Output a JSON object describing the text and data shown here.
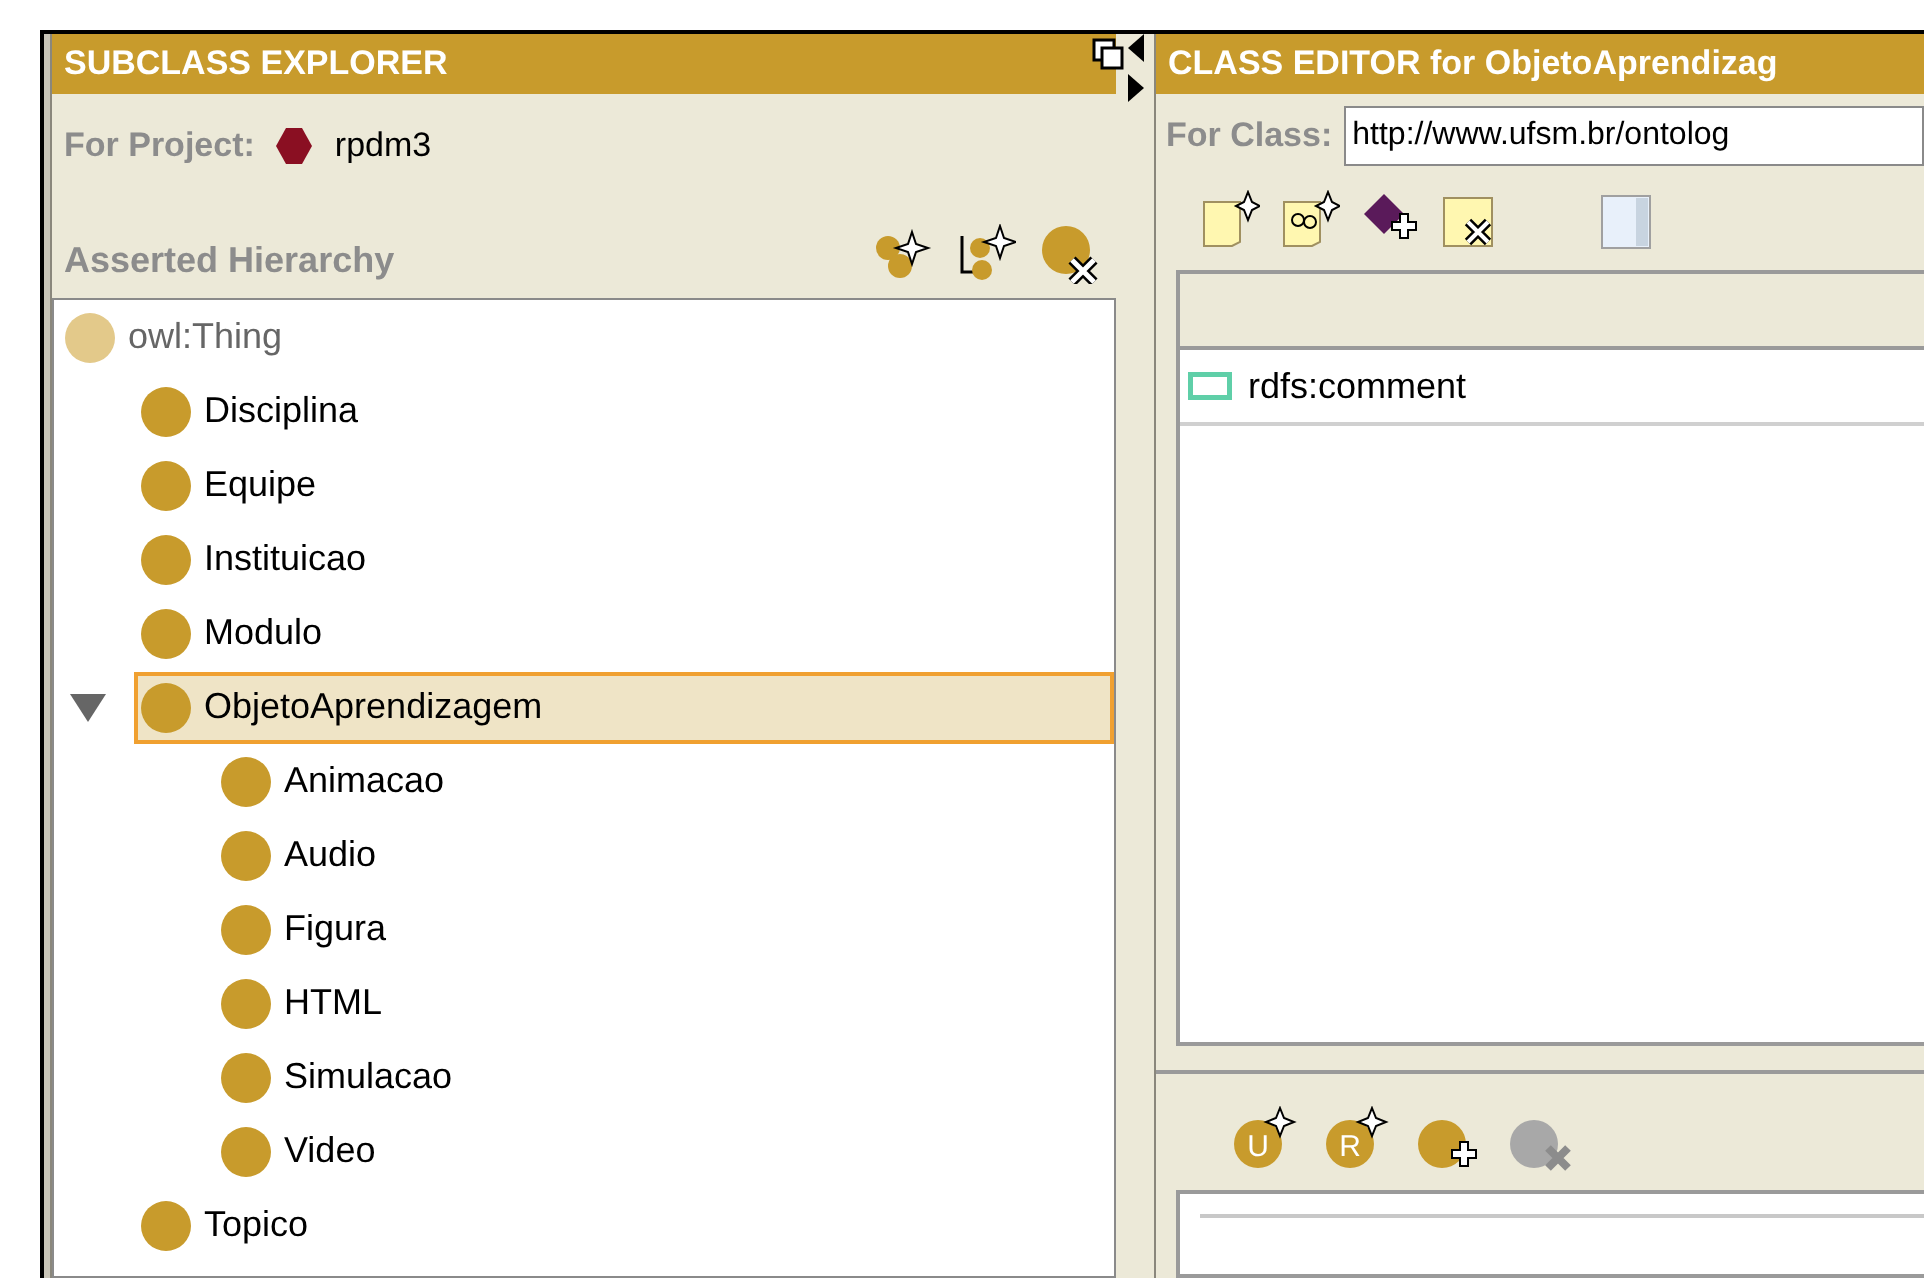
{
  "subclass_explorer": {
    "title": "SUBCLASS EXPLORER",
    "project_label": "For Project:",
    "project_name": "rpdm3",
    "hierarchy_label": "Asserted Hierarchy",
    "tree": [
      {
        "label": "owl:Thing",
        "kind": "root",
        "selected": false,
        "children": [
          {
            "label": "Disciplina",
            "kind": "class",
            "selected": false,
            "expanded": false
          },
          {
            "label": "Equipe",
            "kind": "class",
            "selected": false,
            "expanded": false
          },
          {
            "label": "Instituicao",
            "kind": "class",
            "selected": false,
            "expanded": false
          },
          {
            "label": "Modulo",
            "kind": "class",
            "selected": false,
            "expanded": false
          },
          {
            "label": "ObjetoAprendizagem",
            "kind": "class",
            "selected": true,
            "expanded": true,
            "children": [
              {
                "label": "Animacao",
                "kind": "class",
                "selected": false
              },
              {
                "label": "Audio",
                "kind": "class",
                "selected": false
              },
              {
                "label": "Figura",
                "kind": "class",
                "selected": false
              },
              {
                "label": "HTML",
                "kind": "class",
                "selected": false
              },
              {
                "label": "Simulacao",
                "kind": "class",
                "selected": false
              },
              {
                "label": "Video",
                "kind": "class",
                "selected": false
              }
            ]
          },
          {
            "label": "Topico",
            "kind": "class",
            "selected": false,
            "expanded": false
          }
        ]
      }
    ]
  },
  "class_editor": {
    "title": "CLASS EDITOR for ObjetoAprendizag",
    "class_label": "For Class:",
    "class_value": "http://www.ufsm.br/ontolog",
    "annotations": [
      {
        "label": "rdfs:comment"
      }
    ],
    "lower_toolbar": [
      {
        "glyph": "U",
        "kind": "new",
        "disabled": false
      },
      {
        "glyph": "R",
        "kind": "new",
        "disabled": false
      },
      {
        "kind": "add",
        "disabled": false
      },
      {
        "kind": "remove",
        "disabled": true
      }
    ]
  }
}
